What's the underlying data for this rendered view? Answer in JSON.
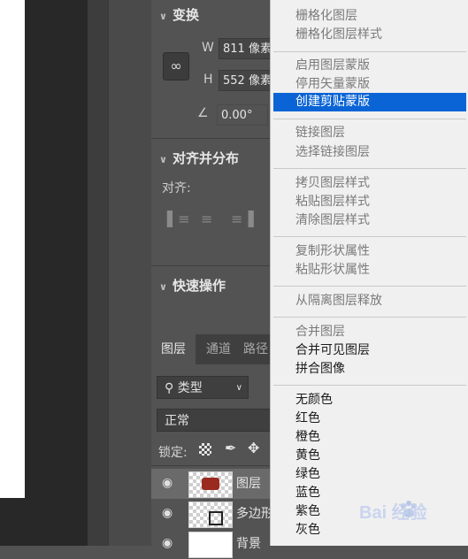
{
  "properties": {
    "transform": {
      "title": "变换",
      "w_label": "W",
      "w_value": "811 像素",
      "h_label": "H",
      "h_value": "552 像素",
      "angle_value": "0.00°"
    },
    "align": {
      "title": "对齐并分布",
      "label": "对齐:"
    },
    "quick": {
      "title": "快速操作"
    }
  },
  "layers_panel": {
    "tabs": [
      "图层",
      "通道",
      "路径"
    ],
    "filter_label": "类型",
    "blend_mode": "正常",
    "lock_label": "锁定:",
    "layers": [
      {
        "name": "图层"
      },
      {
        "name": "多边形"
      },
      {
        "name": "背景"
      }
    ]
  },
  "context_menu": {
    "items": [
      {
        "label": "栅格化图层",
        "enabled": false
      },
      {
        "label": "栅格化图层样式",
        "enabled": false
      },
      {
        "label": "启用图层蒙版",
        "enabled": false
      },
      {
        "label": "停用矢量蒙版",
        "enabled": false
      },
      {
        "label": "创建剪贴蒙版",
        "enabled": true,
        "highlighted": true
      },
      {
        "label": "链接图层",
        "enabled": false
      },
      {
        "label": "选择链接图层",
        "enabled": false
      },
      {
        "label": "拷贝图层样式",
        "enabled": false
      },
      {
        "label": "粘贴图层样式",
        "enabled": false
      },
      {
        "label": "清除图层样式",
        "enabled": false
      },
      {
        "label": "复制形状属性",
        "enabled": false
      },
      {
        "label": "粘贴形状属性",
        "enabled": false
      },
      {
        "label": "从隔离图层释放",
        "enabled": false
      },
      {
        "label": "合并图层",
        "enabled": false
      },
      {
        "label": "合并可见图层",
        "enabled": true
      },
      {
        "label": "拼合图像",
        "enabled": true
      },
      {
        "label": "无颜色",
        "enabled": true
      },
      {
        "label": "红色",
        "enabled": true
      },
      {
        "label": "橙色",
        "enabled": true
      },
      {
        "label": "黄色",
        "enabled": true
      },
      {
        "label": "绿色",
        "enabled": true
      },
      {
        "label": "蓝色",
        "enabled": true
      },
      {
        "label": "紫色",
        "enabled": true
      },
      {
        "label": "灰色",
        "enabled": true
      }
    ]
  },
  "watermark": {
    "text": "Bai 经验"
  },
  "colors": {
    "highlight": "#0a64d6",
    "menu_bg": "#f0f0f0",
    "panel_bg": "#535353"
  }
}
